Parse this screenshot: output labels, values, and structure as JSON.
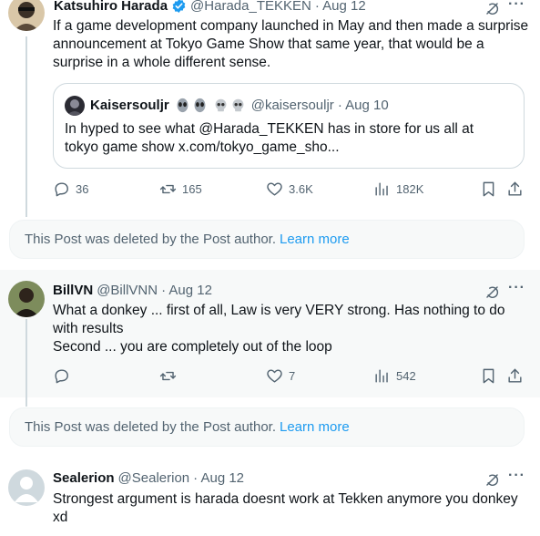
{
  "post": {
    "author_name": "Katsuhiro Harada",
    "handle": "@Harada_TEKKEN",
    "date": "· Aug 12",
    "text": "If a game development company launched in May and then made a surprise announcement at Tokyo Game Show that same year, that would be a surprise in a whole different sense.",
    "quote": {
      "author_name": "Kaisersouljr",
      "handle": "@kaisersouljr",
      "date": "· Aug 10",
      "text": "In hyped to see what @Harada_TEKKEN has in store for us all at tokyo game show x.com/tokyo_game_sho..."
    },
    "actions": {
      "replies": "36",
      "reposts": "165",
      "likes": "3.6K",
      "views": "182K"
    }
  },
  "deleted_1": {
    "text": "This Post was deleted by the Post author.",
    "link": "Learn more"
  },
  "reply_billvn": {
    "author_name": "BillVN",
    "handle": "@BillVNN",
    "date": "· Aug 12",
    "line1": "What a donkey ... first of all, Law is very VERY strong. Has nothing to do with results",
    "line2": "Second ... you are completely out of the loop",
    "actions": {
      "replies": "",
      "reposts": "",
      "likes": "7",
      "views": "542"
    }
  },
  "deleted_2": {
    "text": "This Post was deleted by the Post author.",
    "link": "Learn more"
  },
  "reply_sealerion": {
    "author_name": "Sealerion",
    "handle": "@Sealerion",
    "date": "· Aug 12",
    "text": "Strongest argument is harada doesnt work at Tekken anymore you donkey xd"
  },
  "icons": {
    "verified": "verified-badge-icon",
    "grok": "grok-icon",
    "more": "more-icon",
    "reply": "reply-icon",
    "repost": "repost-icon",
    "like": "like-icon",
    "views": "views-icon",
    "bookmark": "bookmark-icon",
    "share": "share-icon"
  },
  "colors": {
    "link": "#1d9bf0",
    "secondary_text": "#536471",
    "verified": "#1d9bf0"
  }
}
